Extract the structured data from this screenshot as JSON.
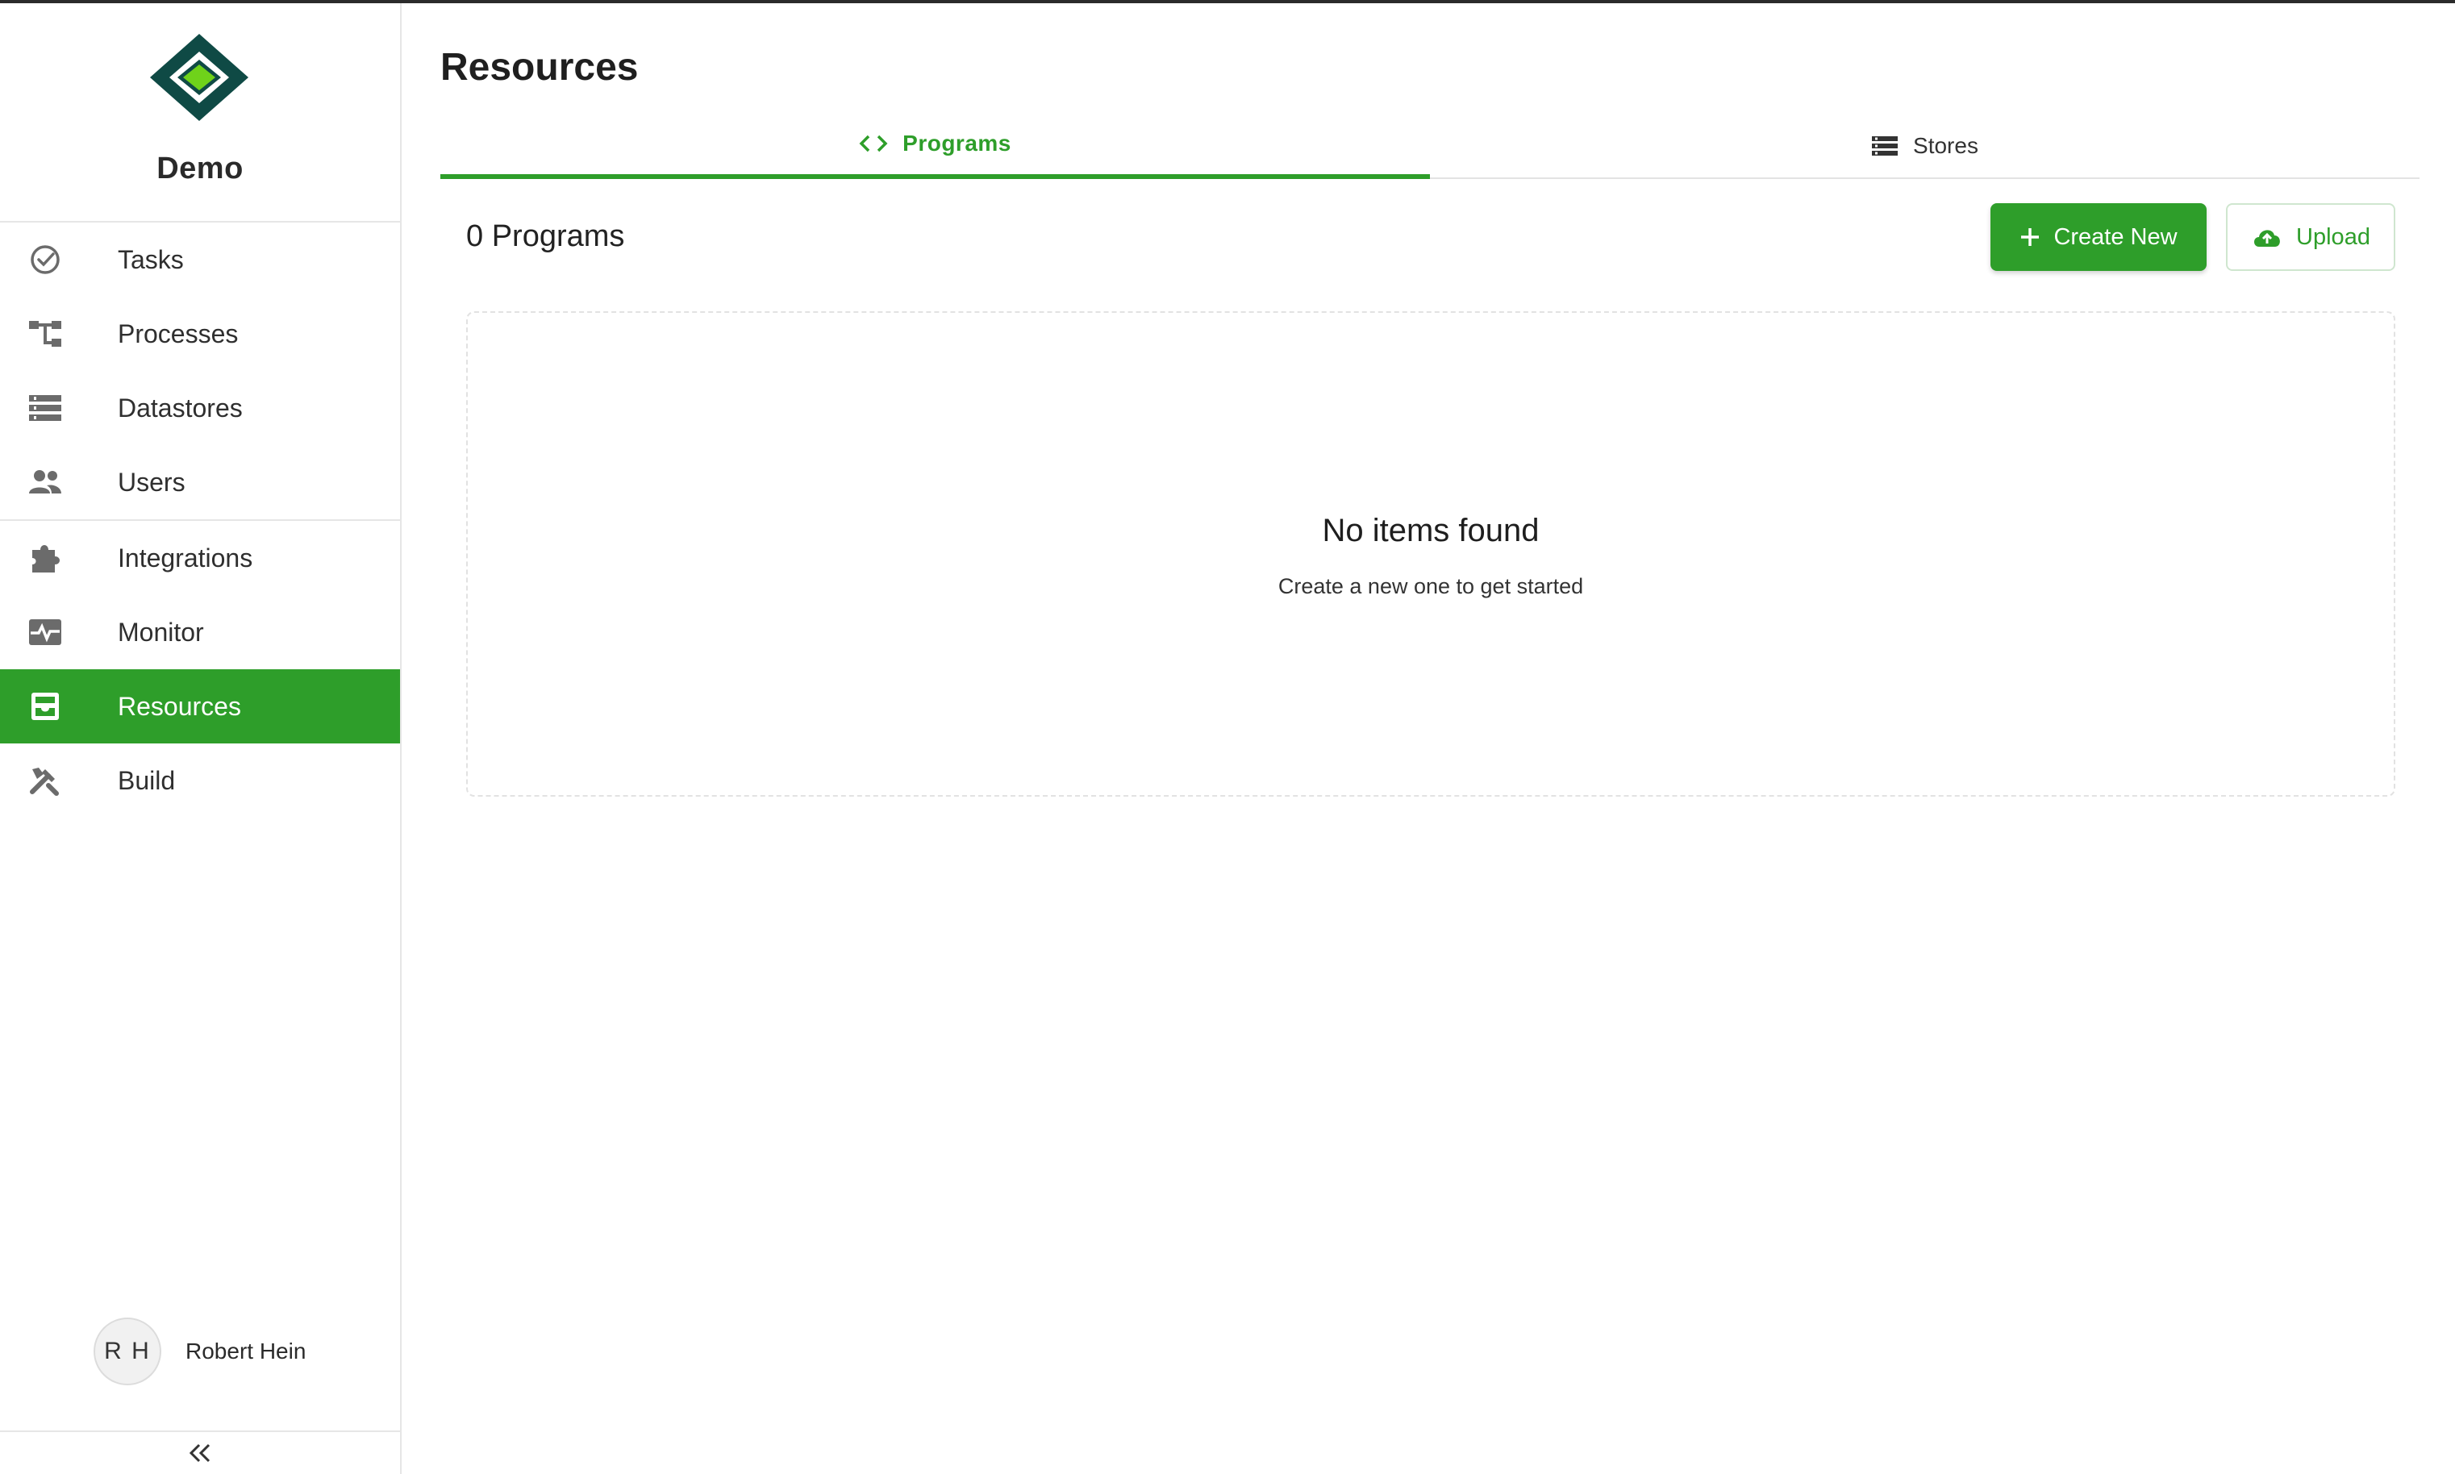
{
  "brand": {
    "name": "Demo"
  },
  "colors": {
    "accent": "#2e9e2a",
    "logo_dark": "#0f4a45",
    "logo_light": "#6fd21a"
  },
  "sidebar": {
    "items": [
      {
        "label": "Tasks",
        "icon": "check-circle-icon"
      },
      {
        "label": "Processes",
        "icon": "hierarchy-icon"
      },
      {
        "label": "Datastores",
        "icon": "list-icon"
      },
      {
        "label": "Users",
        "icon": "users-icon"
      },
      {
        "label": "Integrations",
        "icon": "puzzle-icon"
      },
      {
        "label": "Monitor",
        "icon": "monitor-icon"
      },
      {
        "label": "Resources",
        "icon": "inbox-icon",
        "active": true
      },
      {
        "label": "Build",
        "icon": "tools-icon"
      }
    ]
  },
  "user": {
    "initials": "R H",
    "name": "Robert Hein"
  },
  "collapse": {
    "icon": "double-chevron-left-icon"
  },
  "main": {
    "title": "Resources",
    "tabs": [
      {
        "label": "Programs",
        "icon": "code-icon",
        "active": true
      },
      {
        "label": "Stores",
        "icon": "list-icon",
        "active": false
      }
    ],
    "count_label": "0 Programs",
    "create_label": "Create New",
    "upload_label": "Upload",
    "empty": {
      "title": "No items found",
      "subtitle": "Create a new one to get started"
    }
  }
}
